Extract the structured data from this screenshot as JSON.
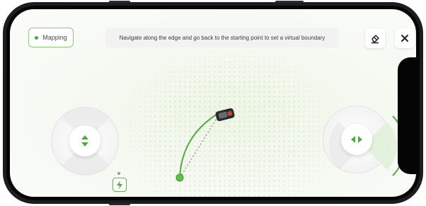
{
  "mapping": {
    "label": "Mapping",
    "status_color": "#3fae3a"
  },
  "instruction": {
    "text": "Navigate along the edge and go back to the starting point to set a virtual boundary"
  },
  "toolbar": {
    "eraser": {
      "icon": "eraser-icon"
    },
    "close": {
      "icon": "close-icon"
    }
  },
  "controls": {
    "left_joystick": {
      "icon": "up-down-arrows-icon"
    },
    "right_joystick": {
      "icon": "left-right-arrows-icon"
    },
    "charge": {
      "icon": "lightning-icon"
    }
  },
  "colors": {
    "accent": "#3fae3a",
    "path": "#4caf3c",
    "dashed": "#9a9a9a"
  }
}
